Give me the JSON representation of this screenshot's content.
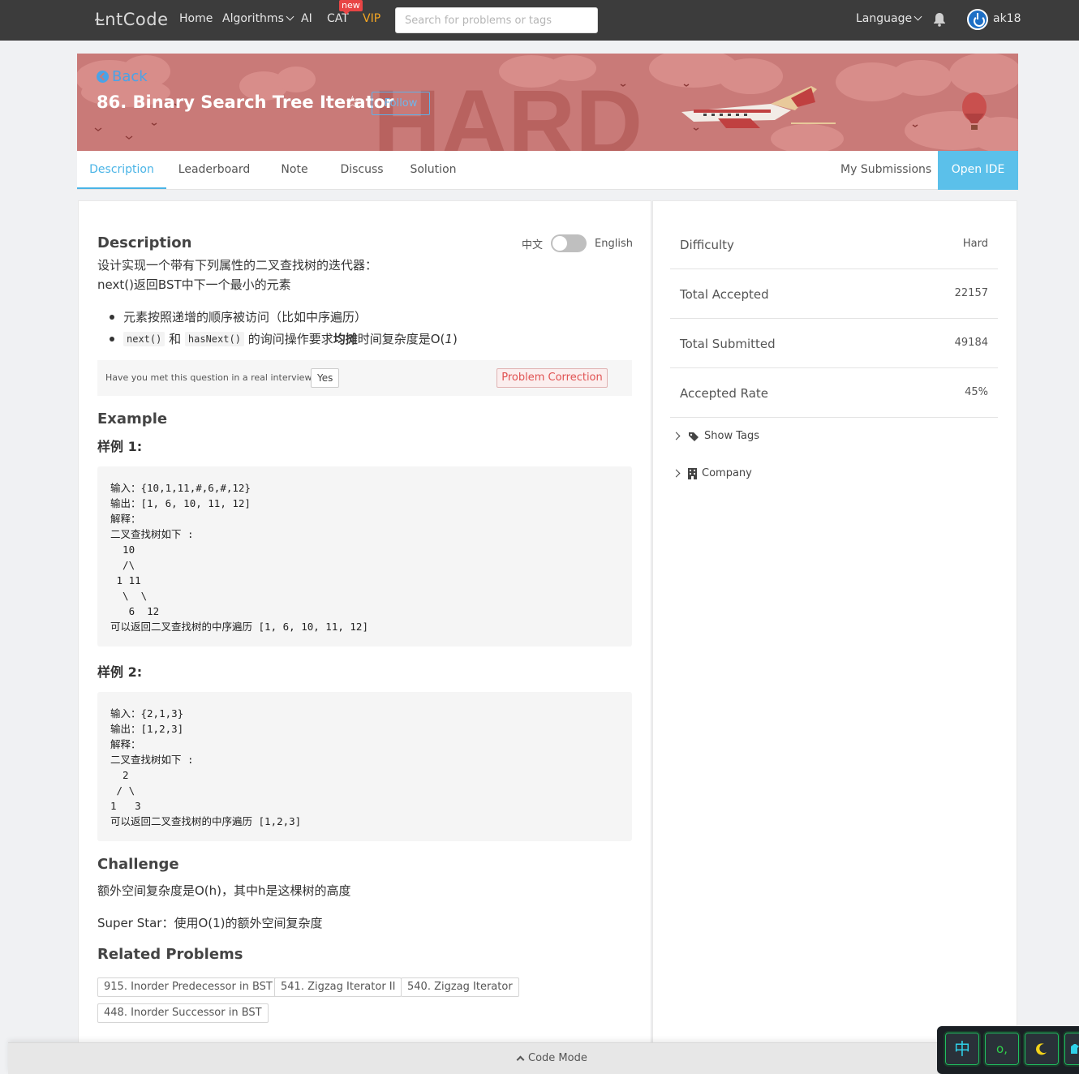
{
  "nav": {
    "logo": "L̴ntCode",
    "home": "Home",
    "algorithms": "Algorithms",
    "ai": "AI",
    "cat": "CAT",
    "cat_badge": "new",
    "vip": "VIP",
    "search_placeholder": "Search for problems or tags",
    "language": "Language",
    "username": "ak18"
  },
  "hero": {
    "back": "Back",
    "title": "86. Binary Search Tree Iterator",
    "follow": "Follow",
    "difficulty_watermark": "HARD"
  },
  "tabs": {
    "description": "Description",
    "leaderboard": "Leaderboard",
    "note": "Note",
    "discuss": "Discuss",
    "solution": "Solution",
    "my_submissions": "My Submissions",
    "open_ide": "Open IDE"
  },
  "description": {
    "heading": "Description",
    "lang_zh": "中文",
    "lang_en": "English",
    "line1": "设计实现一个带有下列属性的二叉查找树的迭代器：",
    "line2": "next()返回BST中下一个最小的元素",
    "bullet1": "元素按照递增的顺序被访问（比如中序遍历）",
    "bullet2_code1": "next()",
    "bullet2_and": " 和 ",
    "bullet2_code2": "hasNext()",
    "bullet2_pre": " 的询问操作要求",
    "bullet2_bold": "均摊",
    "bullet2_post": "时间复杂度是O(",
    "bullet2_italic": "1",
    "bullet2_end": ")",
    "interview_q": "Have you met this question in a real interview?",
    "yes": "Yes",
    "correction": "Problem Correction"
  },
  "example": {
    "heading": "Example",
    "ex1_label": "样例 1:",
    "ex1_code": "输入：{10,1,11,#,6,#,12}\n输出：[1, 6, 10, 11, 12]\n解释：\n二叉查找树如下 :\n  10\n  /\\\n 1 11\n  \\  \\\n   6  12\n可以返回二叉查找树的中序遍历 [1, 6, 10, 11, 12]",
    "ex2_label": "样例 2:",
    "ex2_code": "输入：{2,1,3}\n输出：[1,2,3]\n解释：\n二叉查找树如下 :\n  2\n / \\\n1   3\n可以返回二叉查找树的中序遍历 [1,2,3]"
  },
  "challenge": {
    "heading": "Challenge",
    "line1": "额外空间复杂度是O(h)，其中h是这棵树的高度",
    "line2": "Super Star：使用O(1)的额外空间复杂度"
  },
  "related": {
    "heading": "Related Problems",
    "items": [
      "915. Inorder Predecessor in BST",
      "541. Zigzag Iterator II",
      "540. Zigzag Iterator",
      "448. Inorder Successor in BST"
    ]
  },
  "stats": {
    "difficulty_label": "Difficulty",
    "difficulty_value": "Hard",
    "accepted_label": "Total Accepted",
    "accepted_value": "22157",
    "submitted_label": "Total Submitted",
    "submitted_value": "49184",
    "rate_label": "Accepted Rate",
    "rate_value": "45%",
    "show_tags": "Show Tags",
    "company": "Company"
  },
  "bottom": {
    "code_mode": "Code Mode",
    "ime_key1": "中",
    "ime_key2": "o,"
  },
  "colors": {
    "accent": "#4ab4e6",
    "hero_bg": "#c97a78",
    "danger": "#e05252",
    "vip": "#f5a623"
  }
}
